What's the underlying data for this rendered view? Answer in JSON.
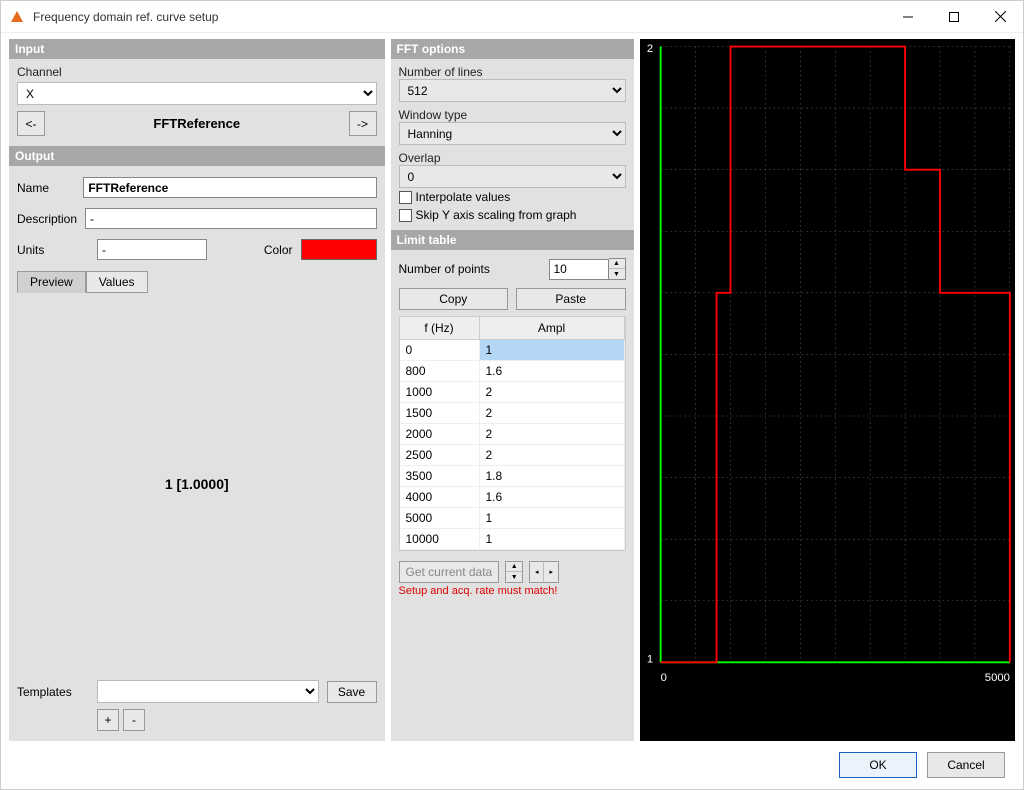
{
  "window": {
    "title": "Frequency domain ref. curve setup"
  },
  "input": {
    "header": "Input",
    "channel_label": "Channel",
    "channel_value": "X",
    "prev_label": "<-",
    "next_label": "->",
    "current_name": "FFTReference"
  },
  "output": {
    "header": "Output",
    "name_label": "Name",
    "name_value": "FFTReference",
    "desc_label": "Description",
    "desc_value": "-",
    "units_label": "Units",
    "units_value": "-",
    "color_label": "Color",
    "color_hex": "#ff0000",
    "tab_preview": "Preview",
    "tab_values": "Values",
    "preview_text": "1 [1.0000]"
  },
  "templates": {
    "label": "Templates",
    "value": "",
    "save": "Save",
    "add": "+",
    "remove": "-"
  },
  "fft": {
    "header": "FFT options",
    "lines_label": "Number of lines",
    "lines_value": "512",
    "window_label": "Window type",
    "window_value": "Hanning",
    "overlap_label": "Overlap",
    "overlap_value": "0",
    "interp_label": "Interpolate values",
    "skipy_label": "Skip Y axis scaling from graph"
  },
  "limit": {
    "header": "Limit table",
    "points_label": "Number of points",
    "points_value": "10",
    "copy": "Copy",
    "paste": "Paste",
    "col_f": "f (Hz)",
    "col_a": "Ampl",
    "rows": [
      {
        "f": "0",
        "a": "1"
      },
      {
        "f": "800",
        "a": "1.6"
      },
      {
        "f": "1000",
        "a": "2"
      },
      {
        "f": "1500",
        "a": "2"
      },
      {
        "f": "2000",
        "a": "2"
      },
      {
        "f": "2500",
        "a": "2"
      },
      {
        "f": "3500",
        "a": "1.8"
      },
      {
        "f": "4000",
        "a": "1.6"
      },
      {
        "f": "5000",
        "a": "1"
      },
      {
        "f": "10000",
        "a": "1"
      }
    ],
    "get_data": "Get current data",
    "warn": "Setup and acq. rate must match!"
  },
  "chart_data": {
    "type": "line",
    "x": [
      0,
      800,
      1000,
      1500,
      2000,
      2500,
      3500,
      4000,
      5000,
      10000
    ],
    "y": [
      1,
      1.6,
      2,
      2,
      2,
      2,
      1.8,
      1.6,
      1,
      1
    ],
    "xlabel": "",
    "ylabel": "",
    "xlim": [
      0,
      5000
    ],
    "ylim": [
      1,
      2
    ],
    "x_ticks": [
      0,
      5000
    ],
    "y_ticks": [
      1,
      2
    ],
    "step_interpolation": true,
    "series_color": "#ff0000",
    "axis_color": "#00ff00",
    "grid_color": "#555555"
  },
  "footer": {
    "ok": "OK",
    "cancel": "Cancel"
  }
}
